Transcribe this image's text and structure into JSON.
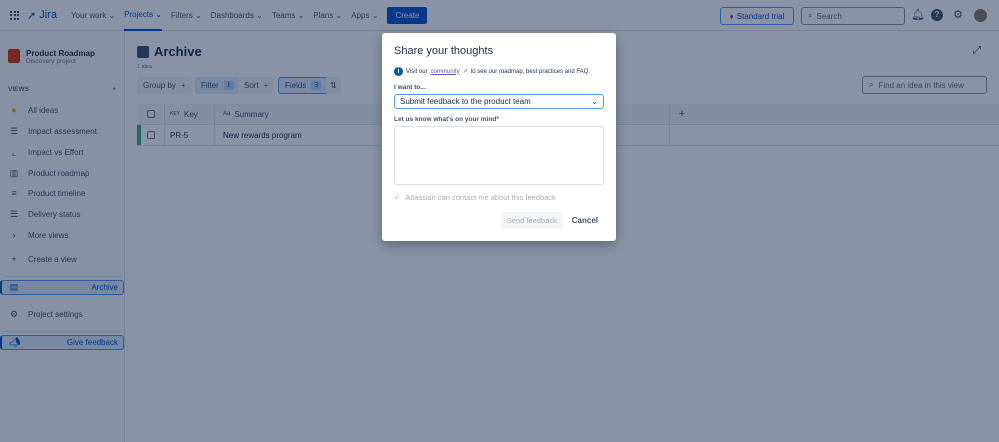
{
  "topbar": {
    "app": "Jira",
    "nav": [
      "Your work",
      "Projects",
      "Filters",
      "Dashboards",
      "Teams",
      "Plans",
      "Apps"
    ],
    "active": "Projects",
    "create": "Create",
    "trial": "Standard trial",
    "search_placeholder": "Search"
  },
  "sidebar": {
    "project_name": "Product Roadmap",
    "project_type": "Discovery project",
    "views_label": "VIEWS",
    "views_add": "+",
    "items": [
      {
        "label": "All ideas",
        "icon": "lightbulb-icon"
      },
      {
        "label": "Impact assessment",
        "icon": "list-icon"
      },
      {
        "label": "Impact vs Effort",
        "icon": "chart-icon"
      },
      {
        "label": "Product roadmap",
        "icon": "board-icon"
      },
      {
        "label": "Product timeline",
        "icon": "timeline-icon"
      },
      {
        "label": "Delivery status",
        "icon": "list-icon"
      },
      {
        "label": "More views",
        "icon": "chevron-right-icon"
      },
      {
        "label": "Create a view",
        "icon": "plus-icon"
      }
    ],
    "archive": "Archive",
    "settings": "Project settings",
    "feedback": "Give feedback"
  },
  "main": {
    "title": "Archive",
    "count": "1 idea",
    "group_by": "Group by",
    "filter": "Filter",
    "filter_count": "1",
    "sort": "Sort",
    "fields": "Fields",
    "fields_count": "3",
    "find_placeholder": "Find an idea in this view",
    "columns": {
      "key_prefix": "KEY",
      "key": "Key",
      "summary_prefix": "Aa",
      "summary": "Summary"
    },
    "rows": [
      {
        "key": "PR-5",
        "summary": "New rewards program"
      }
    ]
  },
  "modal": {
    "title": "Share your thoughts",
    "info_pre": "Visit our",
    "info_link": "community",
    "info_post": "to see our roadmap, best practices and FAQ.",
    "want_label": "I want to...",
    "want_value": "Submit feedback to the product team",
    "mind_label": "Let us know what's on your mind",
    "required": "*",
    "contact": "Atlassian can contact me about this feedback",
    "send": "Send feedback",
    "cancel": "Cancel"
  }
}
